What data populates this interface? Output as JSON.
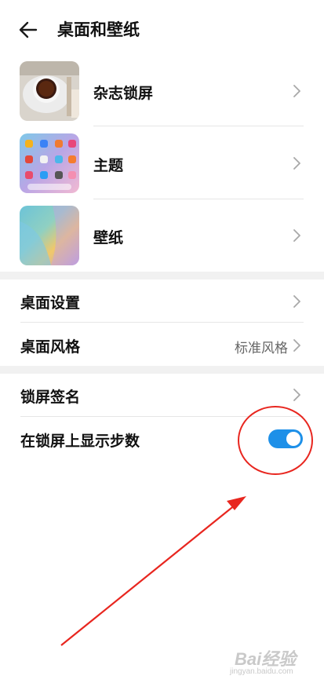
{
  "header": {
    "title": "桌面和壁纸",
    "back_icon": "back-arrow-icon"
  },
  "tiles": [
    {
      "label": "杂志锁屏",
      "icon": "magazine-thumbnail"
    },
    {
      "label": "主题",
      "icon": "theme-thumbnail"
    },
    {
      "label": "壁纸",
      "icon": "wallpaper-thumbnail"
    }
  ],
  "desktop_section": {
    "items": [
      {
        "label": "桌面设置"
      },
      {
        "label": "桌面风格",
        "value": "标准风格"
      }
    ]
  },
  "lock_section": {
    "items": [
      {
        "label": "锁屏签名"
      },
      {
        "label": "在锁屏上显示步数",
        "toggle_on": true
      }
    ]
  },
  "colors": {
    "toggle_on": "#1e90e8",
    "annotation": "#e8261f",
    "section_gap": "#f1f1f1"
  },
  "watermark": {
    "logo": "Bai经验",
    "url": "jingyan.baidu.com"
  }
}
